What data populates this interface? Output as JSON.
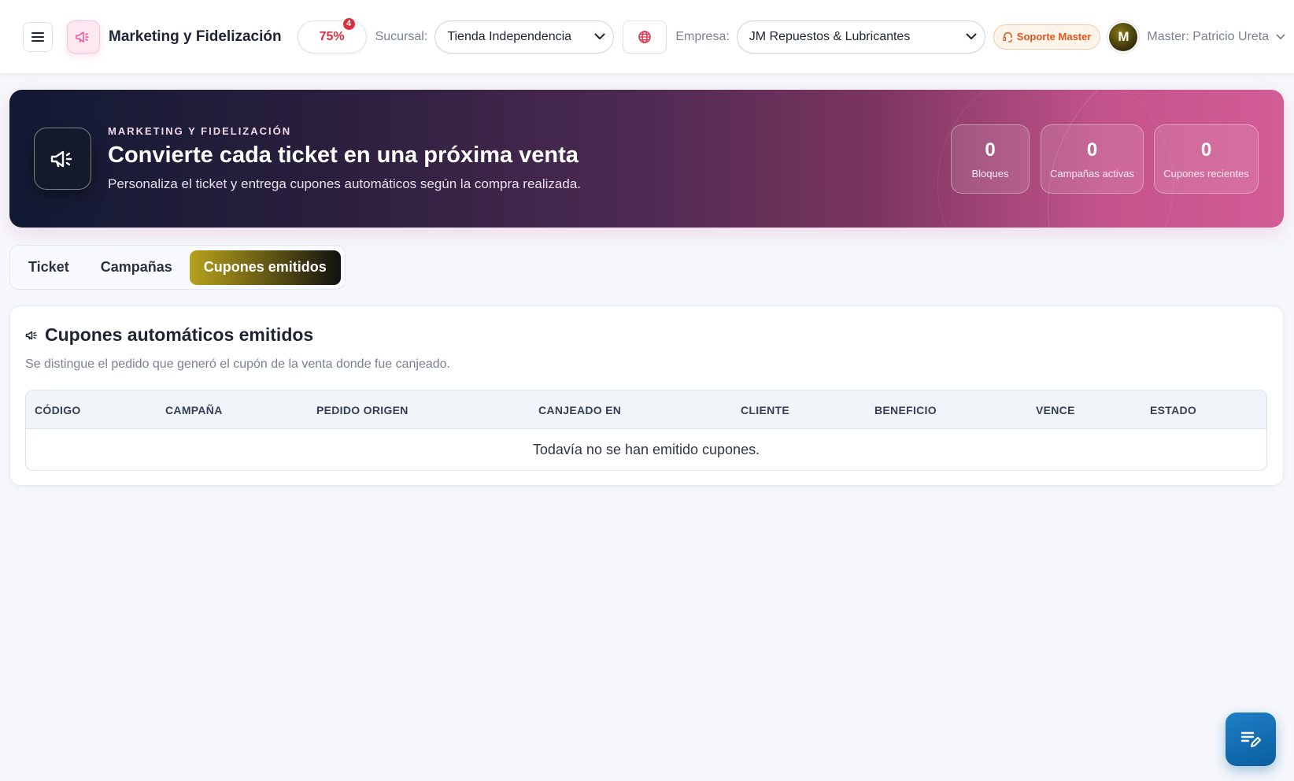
{
  "header": {
    "app_title": "Marketing y Fidelización",
    "progress_label": "75%",
    "notification_count": "4",
    "sucursal_label": "Sucursal:",
    "sucursal_value": "Tienda Independencia",
    "empresa_label": "Empresa:",
    "empresa_value": "JM Repuestos & Lubricantes",
    "support_label": "Soporte Master",
    "avatar_initial": "M",
    "user_name": "Master: Patricio Ureta"
  },
  "hero": {
    "eyebrow": "MARKETING Y FIDELIZACIÓN",
    "title": "Convierte cada ticket en una próxima venta",
    "subtitle": "Personaliza el ticket y entrega cupones automáticos según la compra realizada.",
    "stats": [
      {
        "value": "0",
        "label": "Bloques"
      },
      {
        "value": "0",
        "label": "Campañas activas"
      },
      {
        "value": "0",
        "label": "Cupones recientes"
      }
    ]
  },
  "tabs": [
    {
      "label": "Ticket",
      "active": false
    },
    {
      "label": "Campañas",
      "active": false
    },
    {
      "label": "Cupones emitidos",
      "active": true
    }
  ],
  "card": {
    "title": "Cupones automáticos emitidos",
    "description": "Se distingue el pedido que generó el cupón de la venta donde fue canjeado.",
    "columns": [
      "CÓDIGO",
      "CAMPAÑA",
      "PEDIDO ORIGEN",
      "CANJEADO EN",
      "CLIENTE",
      "BENEFICIO",
      "VENCE",
      "ESTADO"
    ],
    "empty_message": "Todavía no se han emitido cupones."
  },
  "colors": {
    "accent_pink": "#d35c95",
    "hero_dark": "#121a33",
    "progress_red": "#e02c3c",
    "support_orange": "#e1551f",
    "tab_active_gold": "#b7a21e",
    "fab_blue": "#0a5e9e"
  },
  "icons": {
    "menu": "hamburger-icon",
    "module": "megaphone-icon",
    "globe": "globe-icon",
    "support": "headset-icon",
    "user_menu": "chevron-down-icon",
    "fab": "edit-list-icon"
  }
}
